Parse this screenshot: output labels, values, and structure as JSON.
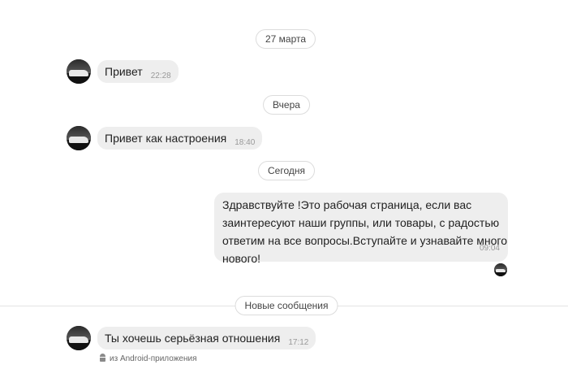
{
  "dates": {
    "march27": "27 марта",
    "yesterday": "Вчера",
    "today": "Сегодня",
    "new_messages": "Новые сообщения"
  },
  "messages": [
    {
      "direction": "incoming",
      "text": "Привет",
      "time": "22:28"
    },
    {
      "direction": "incoming",
      "text": "Привет как настроения",
      "time": "18:40"
    },
    {
      "direction": "outgoing",
      "lines": [
        "Здравствуйте !Это рабочая страница, если вас",
        "заинтересуют наши группы, или товары,  с радостью",
        "ответим на все вопросы.Вступайте и узнавайте много",
        "нового!"
      ],
      "time": "09:04"
    },
    {
      "direction": "incoming",
      "text": "Ты хочешь серьёзная отношения",
      "time": "17:12",
      "source": "из Android-приложения"
    }
  ],
  "icons": {
    "avatar": "avatar-photo",
    "source": "android-icon"
  }
}
